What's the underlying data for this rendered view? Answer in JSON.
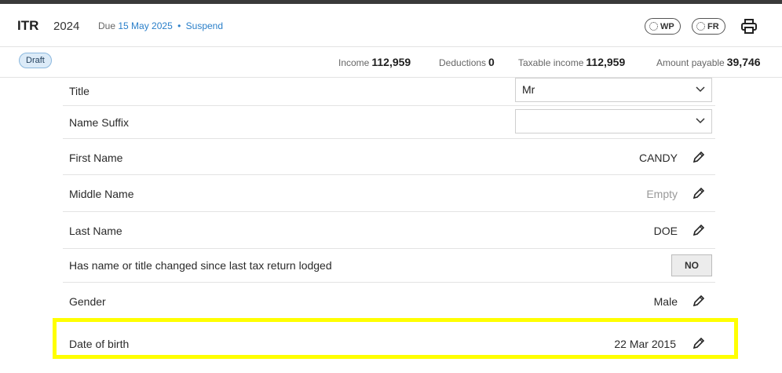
{
  "header": {
    "title": "ITR",
    "year": "2024",
    "due_prefix": "Due",
    "due_date": "15 May 2025",
    "separator": "•",
    "suspend_label": "Suspend",
    "wp_label": "WP",
    "fr_label": "FR",
    "print_icon": "printer-icon"
  },
  "summary": {
    "status": "Draft",
    "income_label": "Income",
    "income_value": "112,959",
    "deductions_label": "Deductions",
    "deductions_value": "0",
    "taxable_label": "Taxable income",
    "taxable_value": "112,959",
    "payable_label": "Amount payable",
    "payable_value": "39,746"
  },
  "form": {
    "title": {
      "label": "Title",
      "value": "Mr"
    },
    "name_suffix": {
      "label": "Name Suffix",
      "value": ""
    },
    "first_name": {
      "label": "First Name",
      "value": "CANDY"
    },
    "middle_name": {
      "label": "Middle Name",
      "value": "Empty"
    },
    "last_name": {
      "label": "Last Name",
      "value": "DOE"
    },
    "name_changed": {
      "label": "Has name or title changed since last tax return lodged",
      "value": "NO"
    },
    "gender": {
      "label": "Gender",
      "value": "Male"
    },
    "dob": {
      "label": "Date of birth",
      "value": "22 Mar 2015"
    }
  },
  "colors": {
    "accent": "#2a7fc9",
    "highlight": "#ffff00",
    "draft_bg": "#dcebf8"
  }
}
